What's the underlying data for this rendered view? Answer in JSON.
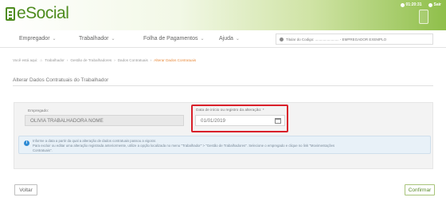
{
  "header": {
    "logo_text": "eSocial",
    "right_items": [
      "01:20:31",
      "Sair"
    ]
  },
  "nav": {
    "items": [
      {
        "label": "Empregador"
      },
      {
        "label": "Trabalhador"
      },
      {
        "label": "Folha de Pagamentos"
      },
      {
        "label": "Ajuda"
      }
    ],
    "user_label": "Titular do Codigo: ........................ - EMPREGADOR EXEMPLO"
  },
  "breadcrumb": {
    "items": [
      "Você está aqui:",
      "Trabalhador",
      "Gestão de Trabalhadores",
      "Dados Contratuais"
    ],
    "active": "Alterar Dados Contratuais"
  },
  "page_title": "Alterar Dados Contratuais do Trabalhador",
  "form": {
    "employee_label": "Empregado:",
    "employee_value": "OLIVIA TRABALHADORA NOME",
    "date_label": "Data de início ou registro da alteração: *",
    "date_value": "01/01/2019"
  },
  "info": {
    "line1": "Informe a data a partir da qual a alteração de dados contratuais passou a vigorar.",
    "line2": "Para excluir ou editar uma alteração registrada anteriormente, utilize a opção localizada no menu \"Trabalhador\" > \"Gestão de Trabalhadores\". Selecione o empregado e clique no link \"Movimentações",
    "line3": "Contratuais\"."
  },
  "buttons": {
    "back": "Voltar",
    "confirm": "Confirmar"
  },
  "colors": {
    "brand_green": "#4e8c1f",
    "highlight_red": "#d9202a",
    "info_blue": "#2f8bd4"
  }
}
